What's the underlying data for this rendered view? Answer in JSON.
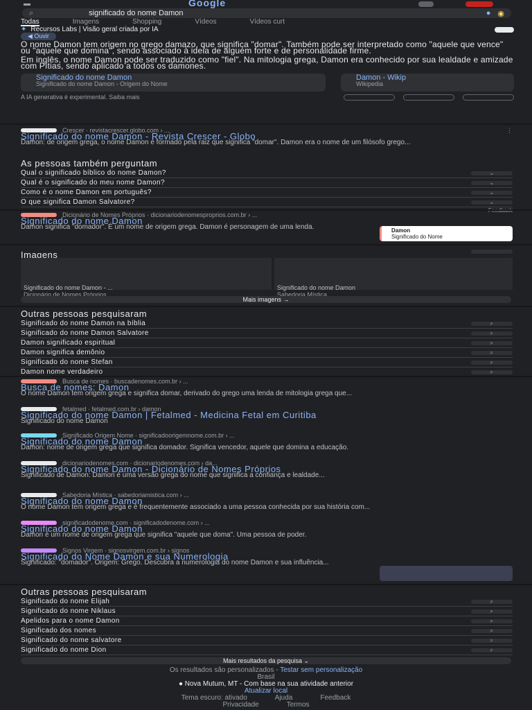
{
  "search": {
    "query": "significado do nome Damon"
  },
  "logo": "Google",
  "tabs": [
    "Todas",
    "Imagens",
    "Shopping",
    "Vídeos",
    "Vídeos curt"
  ],
  "ai_overview": {
    "header": "Recursos Labs | Visão geral criada por IA",
    "listen": "Ouvir",
    "paragraph1": "O nome Damon tem origem no grego damazo, que significa \"domar\". Também pode ser interpretado como \"aquele que vence\" ou \"aquele que domina\", sendo associado à ideia de alguém forte e de personalidade firme.",
    "paragraph2": "Em inglês, o nome Damon pode ser traduzido como \"fiel\". Na mitologia grega, Damon era conhecido por sua lealdade e amizade com Pítias, sendo aplicado a todos os damones.",
    "cards": [
      {
        "title": "Significado do nome Damon",
        "sub": "Significado do nome Damon - Origem do Nome"
      },
      {
        "title": "Damon - Wikip",
        "sub": "Wikipedia"
      }
    ],
    "footer": "A IA generativa é experimental. Saiba mais"
  },
  "results": [
    {
      "source": "Crescer · revistacrescer.globo.com › ...",
      "title": "Significado do nome Damon - Revista Crescer - Globo",
      "snippet": "Damon: de origem grega, o nome Damon é formado pela raiz que significa \"domar\". Damon era o nome de um filósofo grego..."
    },
    {
      "source": "Dicionário de Nomes Próprios · dicionariodenomesproprios.com.br › ...",
      "title": "Significado do nome Damon",
      "snippet": "Damon significa \"domador\". É um nome de origem grega. Damon é personagem de uma lenda."
    },
    {
      "source": "Busca de nomes · buscadenomes.com.br › ...",
      "title": "Busca de nomes: Damon",
      "snippet": "O nome Damon tem origem grega e significa domar, derivado do grego uma lenda de mitologia grega que..."
    },
    {
      "source": "fetalmed · fetalmed.com.br › damon",
      "title": "Significado do nome Damon | Fetalmed - Medicina Fetal em Curitiba",
      "snippet": "Significado do nome Damon"
    },
    {
      "source": "Significado Origem Nome · significadoorigemnome.com.br › ...",
      "title": "Significado do nome Damon",
      "snippet": "Damon: nome de origem grega que significa domador. Significa vencedor, aquele que domina a educação."
    },
    {
      "source": "dicionariodenomes.com · dicionariodenomes.com › da...",
      "title": "Significado do nome Damon - Dicionário de Nomes Próprios",
      "snippet": "Significado de Damon: Damon é uma versão grega do nome que significa a confiança e lealdade..."
    },
    {
      "source": "Sabedoria Mística · sabedoriamistica.com › ...",
      "title": "Significado do nome Damon",
      "snippet": "O nome Damon tem origem grega e é frequentemente associado a uma pessoa conhecida por sua história com..."
    },
    {
      "source": "significadodenome.com · significadodenome.com › ...",
      "title": "Significado do nome Damon",
      "snippet": "Damon é um nome de origem grega que significa \"aquele que doma\". Uma pessoa de poder."
    },
    {
      "source": "Signos Virgem · signosvirgem.com.br › signos",
      "title": "Significado do Nome Damon e sua Numerologia",
      "snippet": "Significado: \"domador\". Origem: Grego. Descubra a numerologia do nome Damon e sua influência..."
    }
  ],
  "paa": {
    "title": "As pessoas também perguntam",
    "questions": [
      "Qual o significado bíblico do nome Damon?",
      "Qual é o significado do meu nome Damon?",
      "Como é o nome Damon em português?",
      "O que significa Damon Salvatore?"
    ],
    "feedback": "Feedback"
  },
  "thumb": {
    "title": "Damon",
    "text": "Significado do Nome"
  },
  "images": {
    "title": "Imagens",
    "captions": [
      "Significado do nome Damon - ...",
      "Significado do nome Damon"
    ],
    "sources": [
      "Dicionário de Nomes Próprios",
      "Sabedoria Mística"
    ],
    "more": "Mais imagens →"
  },
  "related1": {
    "title": "Outras pessoas pesquisaram",
    "items": [
      "Significado do nome Damon na bíblia",
      "Significado do nome Damon Salvatore",
      "Damon significado espiritual",
      "Damon significa demônio",
      "Significado do nome Stefan",
      "Damon nome verdadeiro"
    ]
  },
  "related2": {
    "title": "Outras pessoas pesquisaram",
    "items": [
      "Significado do nome Elijah",
      "Significado do nome Niklaus",
      "Apelidos para o nome Damon",
      "Significado dos nomes",
      "Significado do nome salvatore",
      "Significado do nome Dion"
    ]
  },
  "more_results": "Mais resultados da pesquisa ⌄",
  "footer": {
    "personalized": "Os resultados são personalizados -",
    "try": "Testar sem personalização",
    "brazil": "Brasil",
    "location": "● Nova Mutum, MT - Com base na sua atividade anterior",
    "update": "Atualizar local",
    "links": [
      "Tema escuro: ativado",
      "Ajuda",
      "Feedback"
    ],
    "links2": [
      "Privacidade",
      "Termos"
    ]
  }
}
